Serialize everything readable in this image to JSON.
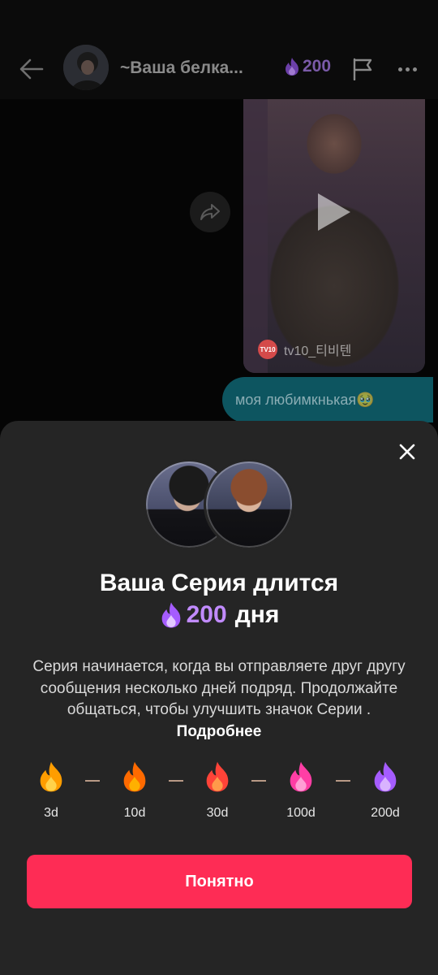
{
  "header": {
    "back_icon": "arrow-left-icon",
    "title": "~Ваша белка...",
    "streak_count": "200",
    "streak_icon": "purple-flame-icon",
    "flag_icon": "flag-icon",
    "more_icon": "more-horizontal-icon"
  },
  "chat": {
    "share_icon": "share-forward-icon",
    "video_watermark": "tv10_티비텐",
    "video_watermark_logo": "TV10",
    "play_icon": "play-icon",
    "message_text": "моя любимкнькая🥹"
  },
  "sheet": {
    "close_icon": "close-icon",
    "title": "Ваша Серия длится",
    "streak_count": "200",
    "streak_unit": "дня",
    "description": "Серия начинается, когда вы отправляете друг другу сообщения несколько дней подряд. Продолжайте общаться, чтобы улучшить значок Серии .",
    "more_link": "Подробнее",
    "milestones": [
      {
        "label": "3d",
        "color_outer": "#ff9d00",
        "color_inner": "#ffd24a"
      },
      {
        "label": "10d",
        "color_outer": "#ff6a00",
        "color_inner": "#ffb000"
      },
      {
        "label": "30d",
        "color_outer": "#ff4338",
        "color_inner": "#ff9a4a"
      },
      {
        "label": "100d",
        "color_outer": "#ff3ea5",
        "color_inner": "#ff9fd4"
      },
      {
        "label": "200d",
        "color_outer": "#a55cff",
        "color_inner": "#d9b3ff"
      }
    ],
    "ok_button": "Понятно"
  },
  "colors": {
    "accent_button": "#fe2c55",
    "streak_purple": "#c18bff",
    "sheet_bg": "#252525",
    "message_bubble": "#0d5560"
  }
}
